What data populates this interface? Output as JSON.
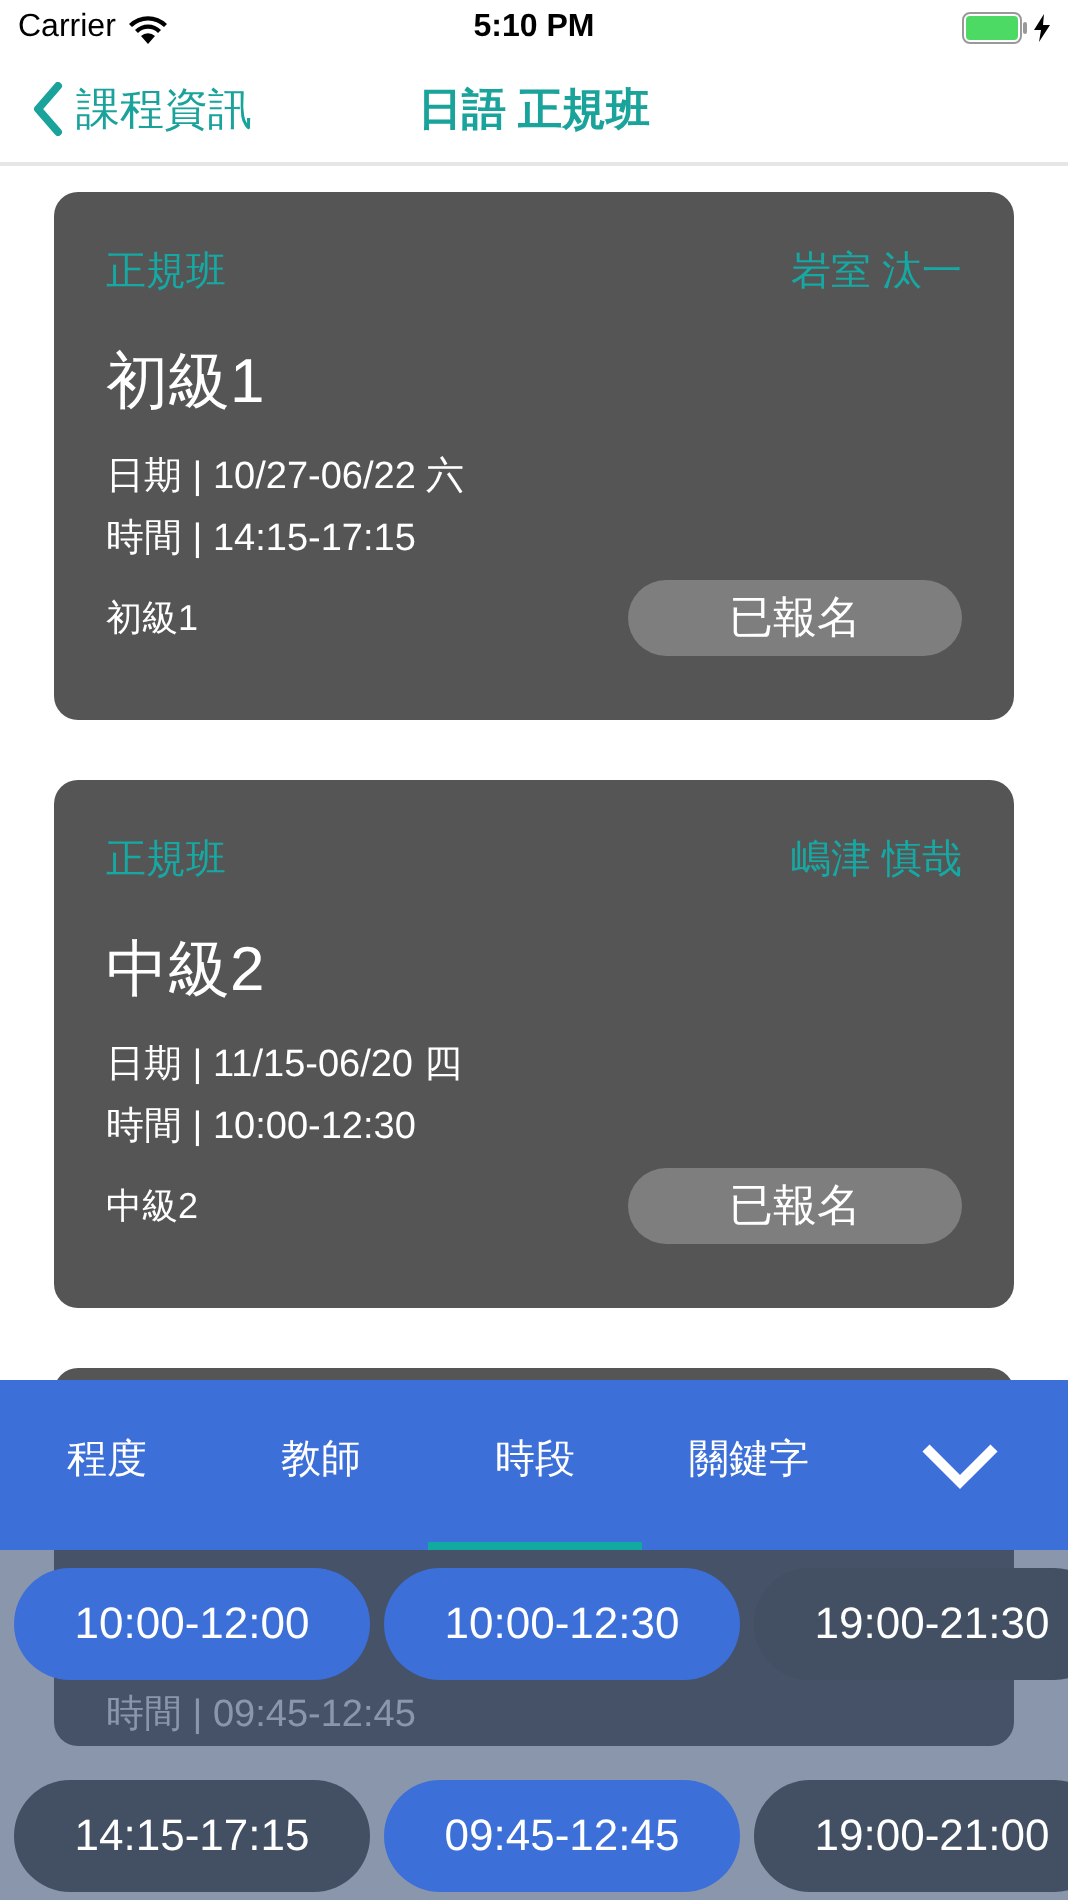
{
  "status_bar": {
    "carrier": "Carrier",
    "time": "5:10 PM"
  },
  "nav": {
    "back": "課程資訊",
    "title": "日語 正規班"
  },
  "cards": [
    {
      "tag": "正規班",
      "teacher": "岩室 汰一",
      "title": "初級1",
      "date": "日期 | 10/27-06/22 六",
      "time": "時間 | 14:15-17:15",
      "note": "初級1",
      "button": "已報名"
    },
    {
      "tag": "正規班",
      "teacher": "嶋津 慎哉",
      "title": "中級2",
      "date": "日期 | 11/15-06/20 四",
      "time": "時間 | 10:00-12:30",
      "note": "中級2",
      "button": "已報名"
    },
    {
      "time": "時間 | 09:45-12:45"
    }
  ],
  "filter": {
    "tabs": [
      {
        "label": "程度",
        "selected": false
      },
      {
        "label": "教師",
        "selected": false
      },
      {
        "label": "時段",
        "selected": true
      },
      {
        "label": "關鍵字",
        "selected": false
      }
    ],
    "chips": [
      {
        "label": "10:00-12:00",
        "selected": true
      },
      {
        "label": "10:00-12:30",
        "selected": true
      },
      {
        "label": "19:00-21:30",
        "selected": false
      },
      {
        "label": "14:15-17:15",
        "selected": false
      },
      {
        "label": "09:45-12:45",
        "selected": true
      },
      {
        "label": "19:00-21:00",
        "selected": false
      }
    ]
  }
}
